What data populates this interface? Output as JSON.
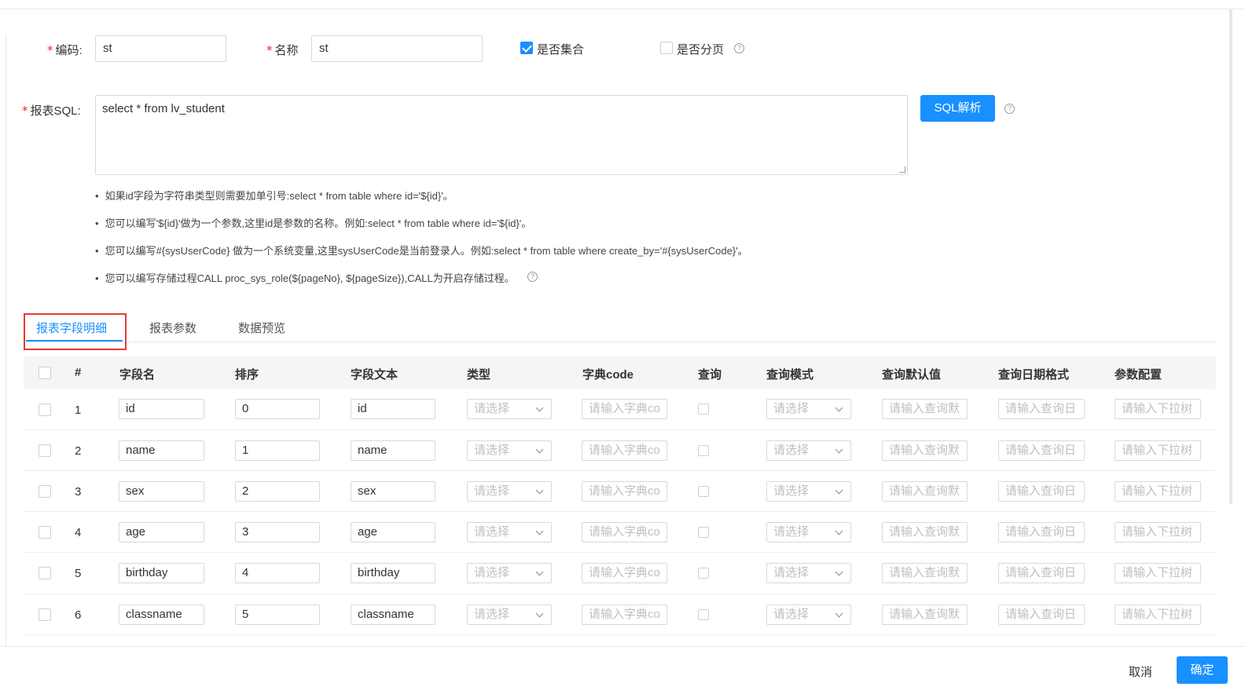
{
  "form": {
    "code_label": "编码:",
    "code_value": "st",
    "name_label": "名称",
    "name_value": "st",
    "is_collection_label": "是否集合",
    "is_collection_checked": true,
    "is_paged_label": "是否分页",
    "is_paged_checked": false,
    "sql_label": "报表SQL:",
    "sql_value": "select *  from lv_student",
    "sql_parse_button": "SQL解析",
    "help_glyph": "?"
  },
  "tips": [
    "如果id字段为字符串类型则需要加单引号:select * from table where id='${id}'。",
    "您可以编写'${id}'做为一个参数,这里id是参数的名称。例如:select * from table where id='${id}'。",
    "您可以编写#{sysUserCode} 做为一个系统变量,这里sysUserCode是当前登录人。例如:select * from table where create_by='#{sysUserCode}'。",
    "您可以编写存储过程CALL proc_sys_role(${pageNo}, ${pageSize}),CALL为开启存储过程。"
  ],
  "tabs": [
    "报表字段明细",
    "报表参数",
    "数据预览"
  ],
  "table": {
    "headers": [
      "#",
      "字段名",
      "排序",
      "字段文本",
      "类型",
      "字典code",
      "查询",
      "查询模式",
      "查询默认值",
      "查询日期格式",
      "参数配置"
    ],
    "placeholders": {
      "type": "请选择",
      "dict_code": "请输入字典co",
      "query_mode": "请选择",
      "query_default": "请输入查询默",
      "query_date_format": "请输入查询日",
      "param_config": "请输入下拉树"
    },
    "rows": [
      {
        "num": "1",
        "field_name": "id",
        "order": "0",
        "field_text": "id"
      },
      {
        "num": "2",
        "field_name": "name",
        "order": "1",
        "field_text": "name"
      },
      {
        "num": "3",
        "field_name": "sex",
        "order": "2",
        "field_text": "sex"
      },
      {
        "num": "4",
        "field_name": "age",
        "order": "3",
        "field_text": "age"
      },
      {
        "num": "5",
        "field_name": "birthday",
        "order": "4",
        "field_text": "birthday"
      },
      {
        "num": "6",
        "field_name": "classname",
        "order": "5",
        "field_text": "classname"
      }
    ]
  },
  "footer": {
    "cancel": "取消",
    "confirm": "确定"
  },
  "colors": {
    "primary": "#1890ff",
    "required": "#f5222d",
    "highlight_box": "#e53935"
  }
}
